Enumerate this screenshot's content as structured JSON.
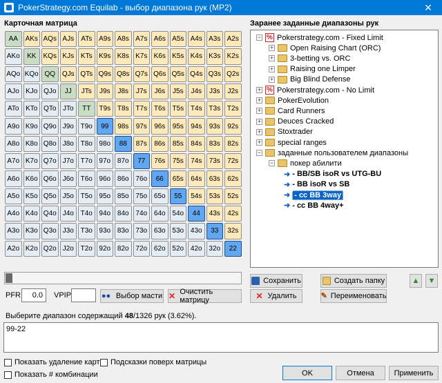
{
  "window": {
    "title": "PokerStrategy.com Equilab - выбор диапазона рук (MP2)",
    "close": "✕"
  },
  "matrix": {
    "label": "Карточная матрица",
    "rows": [
      [
        "AA",
        "AKs",
        "AQs",
        "AJs",
        "ATs",
        "A9s",
        "A8s",
        "A7s",
        "A6s",
        "A5s",
        "A4s",
        "A3s",
        "A2s"
      ],
      [
        "AKo",
        "KK",
        "KQs",
        "KJs",
        "KTs",
        "K9s",
        "K8s",
        "K7s",
        "K6s",
        "K5s",
        "K4s",
        "K3s",
        "K2s"
      ],
      [
        "AQo",
        "KQo",
        "QQ",
        "QJs",
        "QTs",
        "Q9s",
        "Q8s",
        "Q7s",
        "Q6s",
        "Q5s",
        "Q4s",
        "Q3s",
        "Q2s"
      ],
      [
        "AJo",
        "KJo",
        "QJo",
        "JJ",
        "JTs",
        "J9s",
        "J8s",
        "J7s",
        "J6s",
        "J5s",
        "J4s",
        "J3s",
        "J2s"
      ],
      [
        "ATo",
        "KTo",
        "QTo",
        "JTo",
        "TT",
        "T9s",
        "T8s",
        "T7s",
        "T6s",
        "T5s",
        "T4s",
        "T3s",
        "T2s"
      ],
      [
        "A9o",
        "K9o",
        "Q9o",
        "J9o",
        "T9o",
        "99",
        "98s",
        "97s",
        "96s",
        "95s",
        "94s",
        "93s",
        "92s"
      ],
      [
        "A8o",
        "K8o",
        "Q8o",
        "J8o",
        "T8o",
        "98o",
        "88",
        "87s",
        "86s",
        "85s",
        "84s",
        "83s",
        "82s"
      ],
      [
        "A7o",
        "K7o",
        "Q7o",
        "J7o",
        "T7o",
        "97o",
        "87o",
        "77",
        "76s",
        "75s",
        "74s",
        "73s",
        "72s"
      ],
      [
        "A6o",
        "K6o",
        "Q6o",
        "J6o",
        "T6o",
        "96o",
        "86o",
        "76o",
        "66",
        "65s",
        "64s",
        "63s",
        "62s"
      ],
      [
        "A5o",
        "K5o",
        "Q5o",
        "J5o",
        "T5o",
        "95o",
        "85o",
        "75o",
        "65o",
        "55",
        "54s",
        "53s",
        "52s"
      ],
      [
        "A4o",
        "K4o",
        "Q4o",
        "J4o",
        "T4o",
        "94o",
        "84o",
        "74o",
        "64o",
        "54o",
        "44",
        "43s",
        "42s"
      ],
      [
        "A3o",
        "K3o",
        "Q3o",
        "J3o",
        "T3o",
        "93o",
        "83o",
        "73o",
        "63o",
        "53o",
        "43o",
        "33",
        "32s"
      ],
      [
        "A2o",
        "K2o",
        "Q2o",
        "J2o",
        "T2o",
        "92o",
        "82o",
        "72o",
        "62o",
        "52o",
        "42o",
        "32o",
        "22"
      ]
    ],
    "selected": [
      "99",
      "88",
      "77",
      "66",
      "55",
      "44",
      "33",
      "22"
    ]
  },
  "ranges": {
    "label": "Заранее заданные диапазоны рук",
    "nodes": [
      {
        "text": "Pokerstrategy.com - Fixed Limit",
        "icon": "ps",
        "exp": "−",
        "level": 0
      },
      {
        "text": "Open Raising Chart (ORC)",
        "icon": "folder",
        "exp": "+",
        "level": 1
      },
      {
        "text": "3-betting vs. ORC",
        "icon": "folder",
        "exp": "+",
        "level": 1
      },
      {
        "text": "Raising one Limper",
        "icon": "folder",
        "exp": "+",
        "level": 1
      },
      {
        "text": "Big Blind Defense",
        "icon": "folder",
        "exp": "+",
        "level": 1
      },
      {
        "text": "Pokerstrategy.com - No Limit",
        "icon": "ps",
        "exp": "+",
        "level": 0
      },
      {
        "text": "PokerEvolution",
        "icon": "folder",
        "exp": "+",
        "level": 0
      },
      {
        "text": "Card Runners",
        "icon": "folder",
        "exp": "+",
        "level": 0
      },
      {
        "text": "Deuces Cracked",
        "icon": "folder",
        "exp": "+",
        "level": 0
      },
      {
        "text": "Stoxtrader",
        "icon": "folder",
        "exp": "+",
        "level": 0
      },
      {
        "text": "special ranges",
        "icon": "folder",
        "exp": "+",
        "level": 0
      },
      {
        "text": "заданные пользователем диапазоны",
        "icon": "folder",
        "exp": "−",
        "level": 0
      },
      {
        "text": "покер абилити",
        "icon": "folder",
        "exp": "−",
        "level": 1
      },
      {
        "text": "BB/SB isoR vs UTG-BU",
        "icon": "arrow",
        "exp": "",
        "level": 2
      },
      {
        "text": "BB isoR vs SB",
        "icon": "arrow",
        "exp": "",
        "level": 2
      },
      {
        "text": "cc BB 3way",
        "icon": "arrow",
        "exp": "",
        "level": 2,
        "selected": true
      },
      {
        "text": "cc BB 4way+",
        "icon": "arrow",
        "exp": "",
        "level": 2
      }
    ]
  },
  "buttons": {
    "save": "Сохранить",
    "create_folder": "Создать папку",
    "delete": "Удалить",
    "rename": "Переименовать",
    "select_suits": "Выбор масти",
    "clear_matrix": "Очистить матрицу",
    "ok": "OK",
    "cancel": "Отмена",
    "apply": "Применить"
  },
  "inputs": {
    "pfr_label": "PFR:",
    "pfr_value": "0.0",
    "vpip_label": "VPIP:",
    "vpip_value": ""
  },
  "status": {
    "prefix": "Выберите диапазон содержащий ",
    "count": "48",
    "suffix": "/1326 рук (3.62%)."
  },
  "range_text": "99-22",
  "checkboxes": {
    "show_removal": "Показать удаление карт",
    "hints": "Подсказки поверх матрицы",
    "show_combos": "Показать # комбинации"
  },
  "colors": {
    "selected": "#62a6ef",
    "pair": "#c9dcc4",
    "suited": "#fde9b9",
    "offsuit": "#e3edf3"
  }
}
